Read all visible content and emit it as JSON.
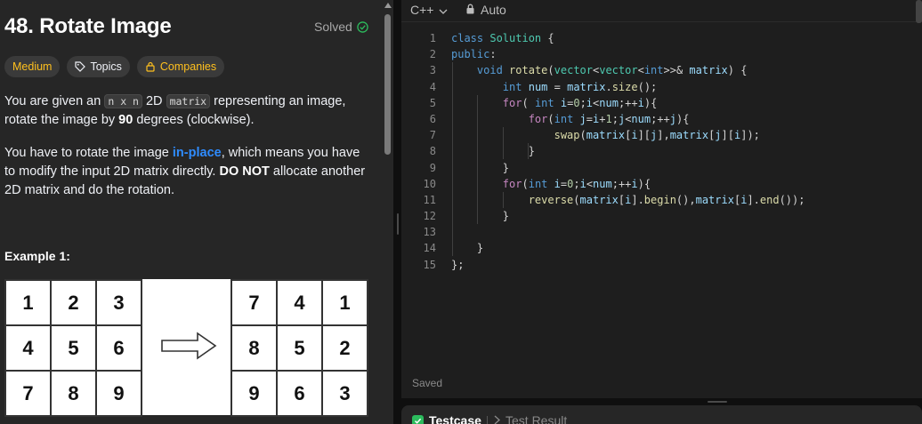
{
  "problem": {
    "title": "48. Rotate Image",
    "status": "Solved",
    "tags": {
      "difficulty": "Medium",
      "topics": "Topics",
      "companies": "Companies"
    },
    "description": {
      "p1_a": "You are given an ",
      "p1_code1": "n x n",
      "p1_b": " 2D ",
      "p1_code2": "matrix",
      "p1_c": " representing an image, rotate the image by ",
      "p1_bold": "90",
      "p1_d": " degrees (clockwise).",
      "p2_a": "You have to rotate the image ",
      "p2_link": "in-place",
      "p2_b": ", which means you have to modify the input 2D matrix directly. ",
      "p2_bold": "DO NOT",
      "p2_c": " allocate another 2D matrix and do the rotation."
    },
    "example": {
      "title": "Example 1:",
      "input_matrix": [
        "1",
        "2",
        "3",
        "4",
        "5",
        "6",
        "7",
        "8",
        "9"
      ],
      "output_matrix": [
        "7",
        "4",
        "1",
        "8",
        "5",
        "2",
        "9",
        "6",
        "3"
      ]
    }
  },
  "editor": {
    "language": "C++",
    "mode": "Auto",
    "status": "Saved",
    "line_numbers": [
      "1",
      "2",
      "3",
      "4",
      "5",
      "6",
      "7",
      "8",
      "9",
      "10",
      "11",
      "12",
      "13",
      "14",
      "15"
    ]
  },
  "bottom": {
    "tab_testcase": "Testcase",
    "tab_result": "Test Result"
  },
  "colors": {
    "accent_difficulty": "#ffc01e",
    "link": "#2f8cff",
    "solved_check": "#2cbb5d"
  }
}
